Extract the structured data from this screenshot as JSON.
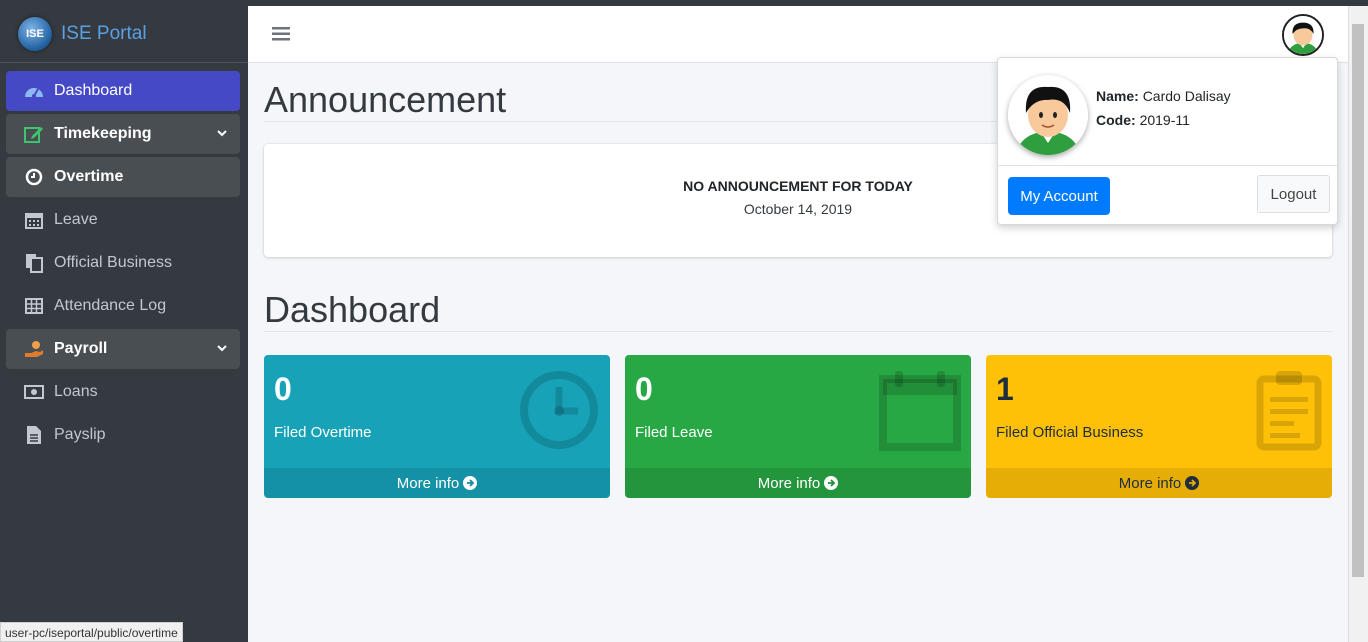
{
  "brand": {
    "logo_text": "ISE",
    "title": "ISE Portal"
  },
  "sidebar": {
    "items": [
      {
        "label": "Dashboard",
        "icon": "tachometer-icon"
      },
      {
        "label": "Timekeeping",
        "icon": "edit-icon"
      },
      {
        "label": "Overtime",
        "icon": "clock-icon"
      },
      {
        "label": "Leave",
        "icon": "calendar-icon"
      },
      {
        "label": "Official Business",
        "icon": "copy-icon"
      },
      {
        "label": "Attendance Log",
        "icon": "table-icon"
      },
      {
        "label": "Payroll",
        "icon": "hand-money-icon"
      },
      {
        "label": "Loans",
        "icon": "money-bill-icon"
      },
      {
        "label": "Payslip",
        "icon": "file-icon"
      }
    ]
  },
  "status_bar": {
    "url": "user-pc/iseportal/public/overtime"
  },
  "announcement": {
    "heading": "Announcement",
    "message": "NO ANNOUNCEMENT FOR TODAY",
    "date": "October 14, 2019"
  },
  "dashboard": {
    "heading": "Dashboard",
    "boxes": [
      {
        "count": "0",
        "label": "Filed Overtime",
        "footer": "More info",
        "icon": "clock-icon",
        "color": "#17a2b8"
      },
      {
        "count": "0",
        "label": "Filed Leave",
        "footer": "More info",
        "icon": "calendar-icon",
        "color": "#28a745"
      },
      {
        "count": "1",
        "label": "Filed Official Business",
        "footer": "More info",
        "icon": "clipboard-icon",
        "color": "#ffc107"
      }
    ]
  },
  "user_menu": {
    "name_label": "Name:",
    "name": "Cardo Dalisay",
    "code_label": "Code:",
    "code": "2019-11",
    "account_button": "My Account",
    "logout_button": "Logout"
  },
  "colors": {
    "sidebar_bg": "#343a40",
    "active": "#4549c5",
    "primary": "#007bff"
  }
}
